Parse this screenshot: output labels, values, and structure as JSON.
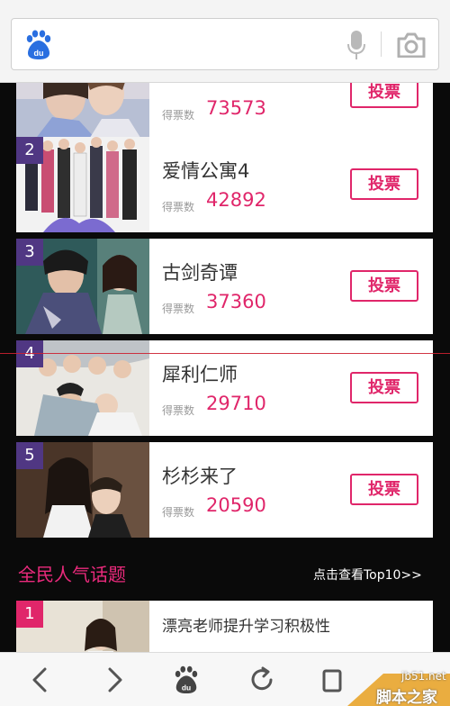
{
  "search": {
    "placeholder": ""
  },
  "dramas": [
    {
      "rank": "",
      "title": "",
      "votes_label": "得票数",
      "votes": "73573",
      "vote_label": "投票"
    },
    {
      "rank": "2",
      "title": "爱情公寓4",
      "votes_label": "得票数",
      "votes": "42892",
      "vote_label": "投票"
    },
    {
      "rank": "3",
      "title": "古剑奇谭",
      "votes_label": "得票数",
      "votes": "37360",
      "vote_label": "投票"
    },
    {
      "rank": "4",
      "title": "犀利仁师",
      "votes_label": "得票数",
      "votes": "29710",
      "vote_label": "投票"
    },
    {
      "rank": "5",
      "title": "杉杉来了",
      "votes_label": "得票数",
      "votes": "20590",
      "vote_label": "投票"
    }
  ],
  "topics": {
    "section_title": "全民人气话题",
    "more_link": "点击查看Top10>>",
    "items": [
      {
        "rank": "1",
        "title": "漂亮老师提升学习积极性"
      }
    ]
  },
  "watermark": {
    "site": "jb51.net",
    "name": "脚本之家"
  },
  "colors": {
    "accent": "#e0266a",
    "rank_badge": "#503783",
    "background": "#0a0a0a"
  }
}
